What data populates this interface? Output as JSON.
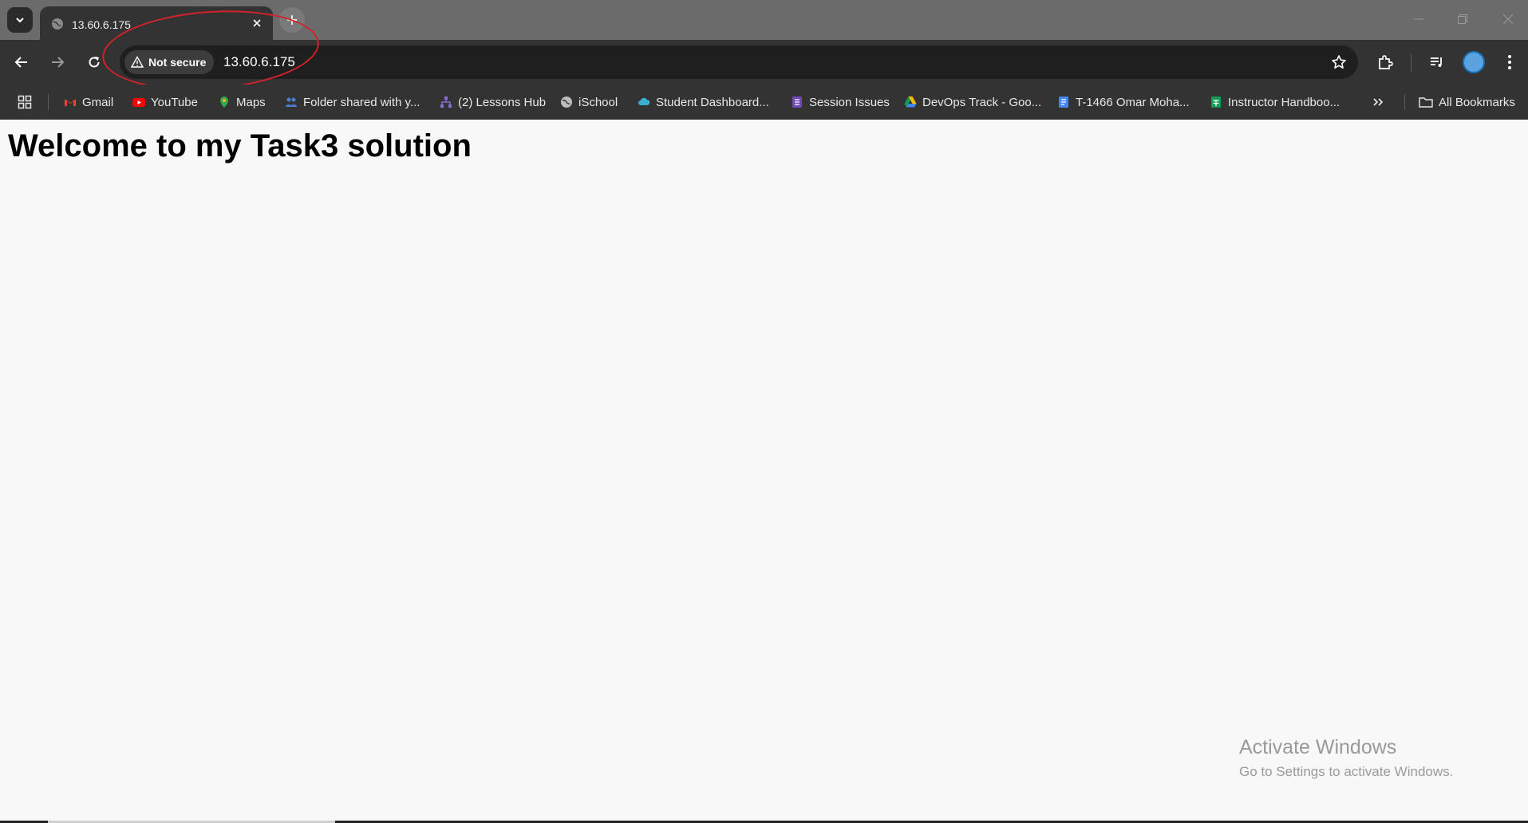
{
  "tab": {
    "title": "13.60.6.175",
    "close_icon": "close-icon"
  },
  "toolbar": {
    "security_label": "Not secure",
    "url": "13.60.6.175"
  },
  "bookmarks": {
    "items": [
      {
        "label": "Gmail",
        "icon": "gmail-icon",
        "color": "#ea4335"
      },
      {
        "label": "YouTube",
        "icon": "youtube-icon",
        "color": "#ff0000"
      },
      {
        "label": "Maps",
        "icon": "maps-icon",
        "color": "#34a853"
      },
      {
        "label": "Folder shared with y...",
        "icon": "people-icon",
        "color": "#4a7fd6"
      },
      {
        "label": "(2) Lessons Hub",
        "icon": "hierarchy-icon",
        "color": "#8b6bd6"
      },
      {
        "label": "iSchool",
        "icon": "globe-icon",
        "color": "#bdbdbd"
      },
      {
        "label": "Student Dashboard...",
        "icon": "cloud-icon",
        "color": "#3ab0d0"
      },
      {
        "label": "Session Issues",
        "icon": "forms-icon",
        "color": "#7248b9"
      },
      {
        "label": "DevOps Track - Goo...",
        "icon": "drive-icon",
        "color": "#fbbc04"
      },
      {
        "label": "T-1466 Omar Moha...",
        "icon": "docs-icon",
        "color": "#4285f4"
      },
      {
        "label": "Instructor Handboo...",
        "icon": "sheets-icon",
        "color": "#0f9d58"
      }
    ],
    "all_bookmarks_label": "All Bookmarks"
  },
  "page": {
    "heading": "Welcome to my Task3 solution"
  },
  "watermark": {
    "title": "Activate Windows",
    "subtitle": "Go to Settings to activate Windows."
  },
  "colors": {
    "annotation": "#d2232a",
    "chrome_dark": "#333333",
    "page_bg": "#f8f8f8"
  }
}
